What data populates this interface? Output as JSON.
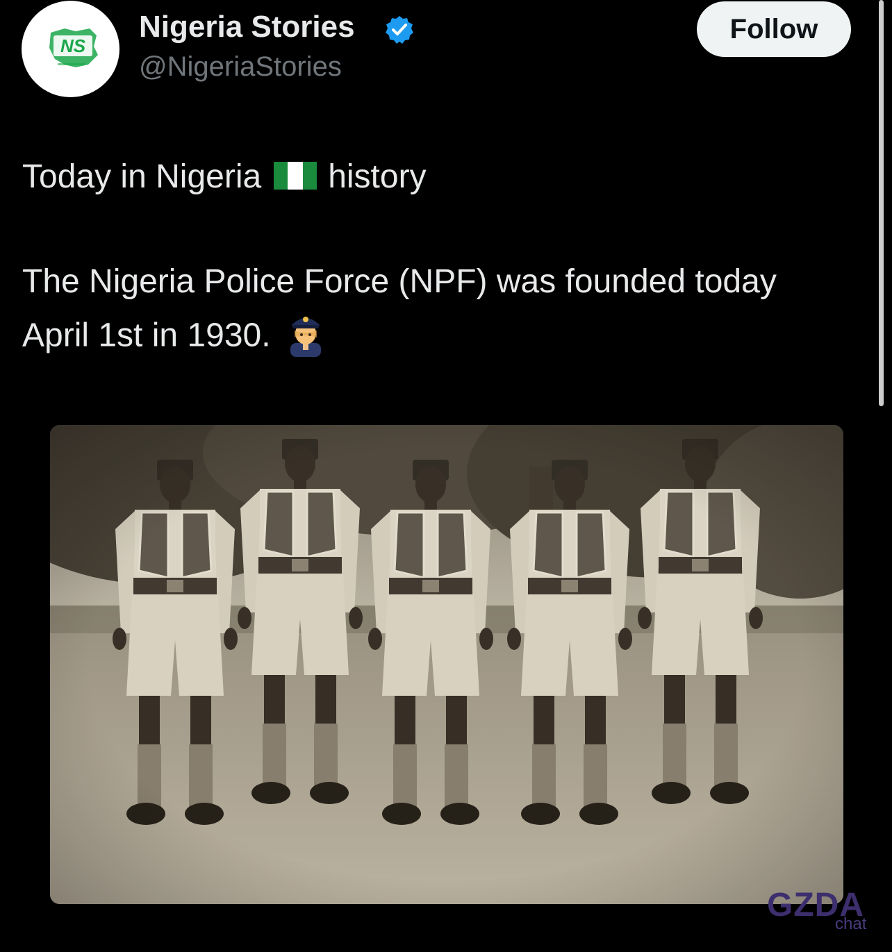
{
  "author": {
    "display_name": "Nigeria Stories",
    "handle": "@NigeriaStories",
    "avatar_initials": "NS",
    "verified": true
  },
  "follow_label": "Follow",
  "tweet": {
    "line1_before": "Today in Nigeria",
    "line1_after": "history",
    "flag_icon": "nigeria-flag-emoji",
    "line2": "The Nigeria Police Force (NPF) was founded today",
    "line3": "April 1st in 1930.",
    "police_icon": "police-officer-emoji"
  },
  "media": {
    "type": "sepia-photo"
  },
  "watermark": {
    "main": "GZDA",
    "sub": "chat"
  },
  "colors": {
    "background": "#000000",
    "text": "#e7e9ea",
    "secondary_text": "#71767b",
    "verified": "#1d9bf0",
    "follow_bg": "#eff3f4",
    "brand_green": "#1aa64a"
  }
}
